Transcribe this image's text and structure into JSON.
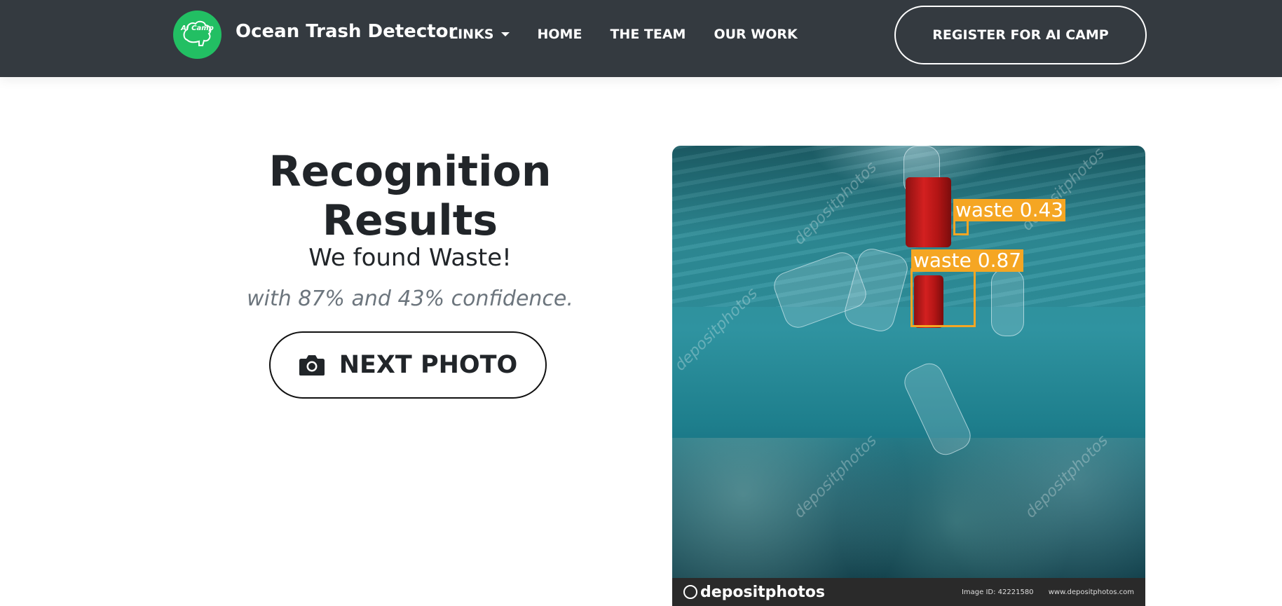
{
  "navbar": {
    "logo_text": "AI Camp",
    "brand_name": "Ocean Trash Detector",
    "links": [
      {
        "label": "LINKS"
      },
      {
        "label": "HOME"
      },
      {
        "label": "THE TEAM"
      },
      {
        "label": "OUR WORK"
      }
    ],
    "register_label": "REGISTER FOR AI CAMP"
  },
  "results": {
    "title": "Recognition Results",
    "found_prefix": "We found",
    "found_object": "Waste!",
    "confidence_text": "with 87% and 43% confidence.",
    "next_button_label": "NEXT PHOTO"
  },
  "photo": {
    "detections": [
      {
        "label": "waste 0.43"
      },
      {
        "label": "waste 0.87"
      }
    ],
    "watermark_text": "depositphotos",
    "footer_brand": "depositphotos",
    "footer_image_id": "Image ID: 42221580",
    "footer_site": "www.depositphotos.com"
  },
  "colors": {
    "navbar_bg": "#343a40",
    "logo_green": "#22bf63",
    "detection_box": "#f5a623"
  }
}
